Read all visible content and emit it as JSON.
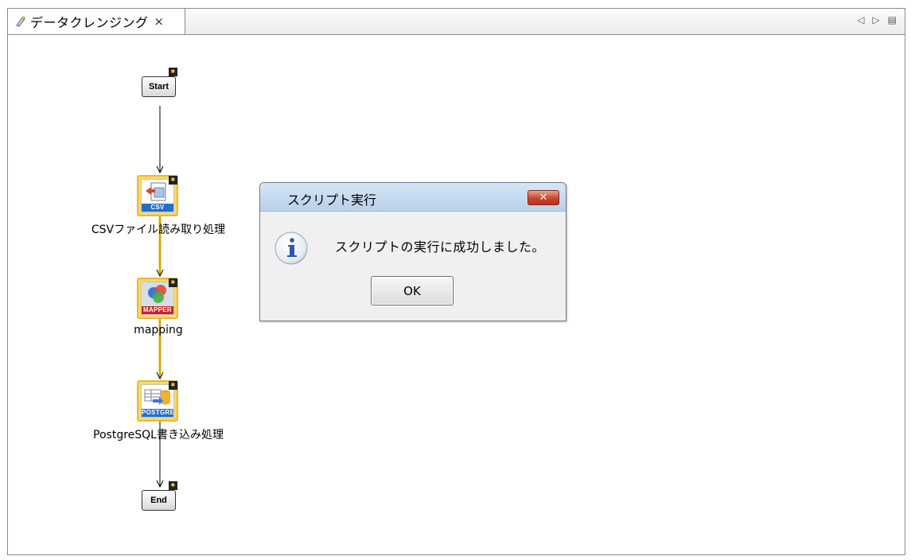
{
  "editor_tab": {
    "title": "データクレンジング",
    "close_glyph": "×",
    "icon": "script-icon"
  },
  "tab_controls": {
    "prev": "◁",
    "next": "▷",
    "menu": "▤"
  },
  "flow": {
    "start_label": "Start",
    "end_label": "End",
    "badge_glyph": "✱",
    "nodes": [
      {
        "label": "CSVファイル読み取り処理",
        "banner": "CSV",
        "icon": "csv-file-icon",
        "banner_color": "#1f6fcf"
      },
      {
        "label": "mapping",
        "banner": "MAPPER",
        "icon": "mapper-icon",
        "banner_color": "#cc2222"
      },
      {
        "label": "PostgreSQL書き込み処理",
        "banner": "POSTGRE",
        "icon": "postgres-icon",
        "banner_color": "#1f6fcf"
      }
    ],
    "link_colors": {
      "plain": "#000000",
      "active": "#e8c020"
    }
  },
  "dialog": {
    "title": "スクリプト実行",
    "close_glyph": "✕",
    "icon": "info-icon",
    "message": "スクリプトの実行に成功しました。",
    "ok_label": "OK"
  }
}
